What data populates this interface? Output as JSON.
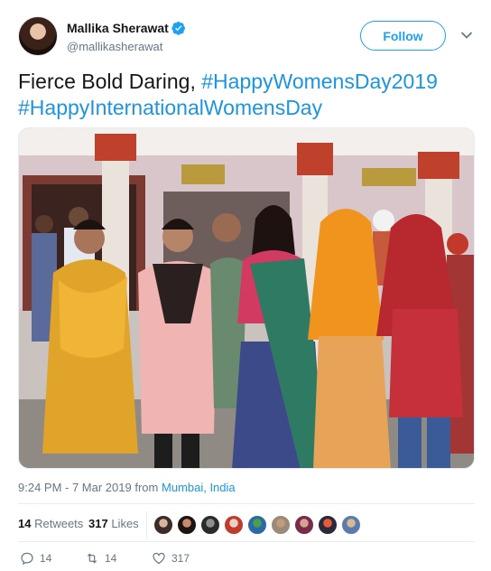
{
  "author": {
    "display_name": "Mallika Sherawat",
    "handle": "@mallikasherawat",
    "verified_icon": "verified-badge-icon",
    "verified_color": "#1da1f2"
  },
  "follow_button": {
    "label": "Follow"
  },
  "menu": {
    "icon": "chevron-down-icon"
  },
  "tweet": {
    "text_plain": "Fierce Bold Daring, ",
    "hashtag_1": "#HappyWomensDay2019",
    "hashtag_2": "#HappyInternationalWomensDay",
    "hashtag_color": "#1b95e0"
  },
  "meta": {
    "timestamp": "9:24 PM - 7 Mar 2019",
    "from_label": "from",
    "location": "Mumbai, India"
  },
  "stats": {
    "retweets_count": "14",
    "retweets_label": "Retweets",
    "likes_count": "317",
    "likes_label": "Likes",
    "liker_avatars": [
      "liker-avatar-1",
      "liker-avatar-2",
      "liker-avatar-3",
      "liker-avatar-4",
      "liker-avatar-5",
      "liker-avatar-6",
      "liker-avatar-7",
      "liker-avatar-8",
      "liker-avatar-9"
    ]
  },
  "actions": {
    "reply_count": "14",
    "retweet_count": "14",
    "like_count": "317",
    "reply_icon": "reply-icon",
    "retweet_icon": "retweet-icon",
    "like_icon": "heart-icon"
  },
  "colors": {
    "accent": "#1da1f2",
    "text_secondary": "#657786",
    "divider": "#e6ecf0"
  }
}
